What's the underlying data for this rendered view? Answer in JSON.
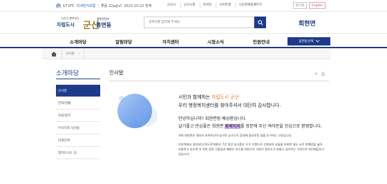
{
  "topbar": {
    "temperature": "17.0℃",
    "dust_label": "미세먼지보통",
    "ultrafine": "좋음 22μg/㎥",
    "date": "2023-10-22 현재",
    "util_links": [
      "군산시",
      "군산시청",
      "모바일",
      "사이트맵",
      "시민명예홈페이지"
    ],
    "login_label": "로그인",
    "lang_label": "English"
  },
  "header": {
    "logo_slogan": "시민이 행복하는",
    "logo_sub": "자립도시",
    "logo_brand": "군산",
    "logo_tag": "행복콘텐츠",
    "logo_dong": "흥면동",
    "search_placeholder": "검색어를 입력해 주세요.",
    "page_name": "회현면"
  },
  "gnb": {
    "items": [
      "소개마당",
      "알림마당",
      "자치센터",
      "시정소식",
      "민원안내"
    ],
    "select_label": "읍면동선택"
  },
  "breadcrumb": {
    "current": "인사말"
  },
  "lnb": {
    "title": "소개마당",
    "items": [
      "인사말",
      "연혁/현황",
      "직원/업무",
      "우리지역 사진들",
      "자생단체",
      "찾아오시는 길"
    ]
  },
  "content": {
    "title": "인사말",
    "headline1_pre": "시민과 함께하는 ",
    "headline1_hl": "자립도시 군산",
    "headline2": "우리 행정복지센터를 찾아주셔서 대단히 감사합니다.",
    "para1_line1": "안녕하십니까? 회현면장 배성환입니다.",
    "para1_pre": "살기좋고 안심좋은 회현면 ",
    "para1_mark": "홈페이지",
    "para1_post": "를 방문해 주신 여러분을 진심으로 환영합니다.",
    "small1": "저희 회현면은 옛부터 미색옥산의 농사로 농가소득 증대에 중요로운 살을 추구하는 고장입니다.",
    "small2": "미지역에서 생산되는(목도전미쌀)은 7년 동안 농식품부 우수 브랜드로 선정되어 씨들을 비롯한 대도 시로 판매망을 넓혀 유통하고 있으며 어 천연 청정 구불길과 배밭산 호숫을 바탕으로 사람이 찾아오고 머물고 싶어하는 고장으로 자리매김하고 있습니다.",
    "small3": "",
    "small4": ""
  },
  "colors": {
    "primary": "#1e3b8a",
    "accent": "#e07a2e",
    "highlight": "#c9a8e8",
    "brand_gold": "#9c7a20"
  }
}
